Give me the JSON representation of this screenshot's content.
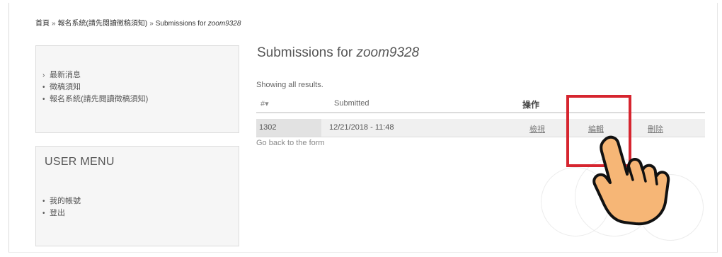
{
  "breadcrumb": {
    "home": "首頁",
    "separator": "»",
    "section": "報名系統(請先閱讀徵稿須知)",
    "current_prefix": "Submissions for ",
    "current_user": "zoom9328"
  },
  "sidebar": {
    "nav_items": [
      {
        "marker": "›",
        "label": "最新消息"
      },
      {
        "marker": "•",
        "label": "徵稿須知"
      },
      {
        "marker": "•",
        "label": "報名系統(請先閱讀徵稿須知)"
      }
    ],
    "user_menu": {
      "title": "USER MENU",
      "items": [
        {
          "marker": "•",
          "label": "我的帳號"
        },
        {
          "marker": "•",
          "label": "登出"
        }
      ]
    }
  },
  "main": {
    "title_prefix": "Submissions for ",
    "title_user": "zoom9328",
    "showing": "Showing all results.",
    "table": {
      "headers": {
        "hash": "#",
        "sort_icon": "▾",
        "submitted": "Submitted",
        "operations": "操作"
      },
      "rows": [
        {
          "id": "1302",
          "submitted": "12/21/2018 - 11:48",
          "view": "檢視",
          "edit": "編輯",
          "delete": "刪除"
        }
      ]
    },
    "back_link": "Go back to the form"
  },
  "annotation": {
    "highlight_color": "#d6252f",
    "hand_icon": "pointing-hand-icon",
    "hand_color": "#f6b676"
  }
}
